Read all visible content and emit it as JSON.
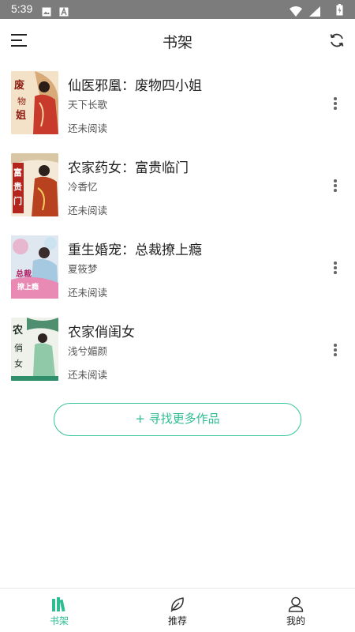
{
  "status_bar": {
    "time": "5:39",
    "left_icons": [
      "image-icon",
      "a-letter-icon"
    ],
    "right_icons": [
      "wifi-icon",
      "signal-icon",
      "battery-icon"
    ]
  },
  "header": {
    "title": "书架",
    "menu_icon": "hamburger-icon",
    "refresh_icon": "refresh-icon"
  },
  "books": [
    {
      "title": "仙医邪凰：废物四小姐",
      "author": "天下长歌",
      "status": "还未阅读",
      "cover_text": "废物小姐"
    },
    {
      "title": "农家药女：富贵临门",
      "author": "冷香忆",
      "status": "还未阅读",
      "cover_text": "富贵临门"
    },
    {
      "title": "重生婚宠：总裁撩上瘾",
      "author": "夏筱梦",
      "status": "还未阅读",
      "cover_text": "总裁撩上瘾"
    },
    {
      "title": "农家俏闺女",
      "author": "浅兮媚颜",
      "status": "还未阅读",
      "cover_text": "农家俏闺女"
    }
  ],
  "find_more_label": "+ 寻找更多作品",
  "bottom_nav": {
    "shelf": "书架",
    "recommend": "推荐",
    "mine": "我的"
  },
  "colors": {
    "accent": "#2ebd93",
    "status_bar": "#7c7c7c"
  }
}
